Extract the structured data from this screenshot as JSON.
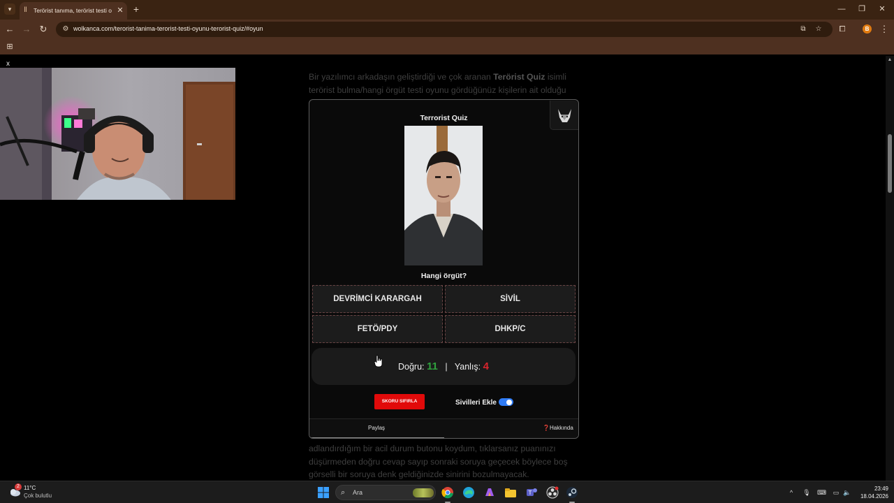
{
  "browser": {
    "tab_title": "Terörist tanıma, terörist testi oyunu - terörist quiz",
    "tab_close": "✕",
    "new_tab": "+",
    "url": "wolkanca.com/terorist-tanima-terorist-testi-oyunu-terorist-quiz/#oyun",
    "profile_initial": "B",
    "icons": [
      "tab-list-icon",
      "tab-favicon-icon",
      "close-icon",
      "plus-icon",
      "minimize-icon",
      "maximize-icon",
      "window-close-icon",
      "back-icon",
      "forward-icon",
      "reload-icon",
      "site-info-icon",
      "install-app-icon",
      "bookmark-star-icon",
      "extensions-icon",
      "menu-icon",
      "apps-grid-icon"
    ]
  },
  "overlay": {
    "close_label": "x"
  },
  "article": {
    "intro_plain_1": "Bir yazılımcı arkadaşın geliştirdiği ve çok aranan ",
    "intro_bold": "Terörist Quiz",
    "intro_plain_2": " isimli",
    "intro_line2": "terörist bulma/hangi örgüt testi oyunu gördüğünüz kişilerin ait olduğu",
    "bottom_line1": "adlandırdığım bir acil durum butonu koydum, tıklarsanız puanınızı",
    "bottom_line2": "düşürmeden doğru cevap sayıp sonraki soruya geçecek böylece boş",
    "bottom_line3": "görselli bir soruya denk geldiğinizde sinirini bozulmayacak."
  },
  "quiz": {
    "title": "Terrorist Quiz",
    "question": "Hangi örgüt?",
    "options": [
      "DEVRİMCİ KARARGAH",
      "SİVİL",
      "FETÖ/PDY",
      "DHKP/C"
    ],
    "score": {
      "correct_label": "Doğru:",
      "correct_value": "11",
      "separator": "|",
      "wrong_label": "Yanlış:",
      "wrong_value": "4"
    },
    "reset_label": "SKORU SIFIRLA",
    "civilians_label": "Sivilleri Ekle",
    "civilians_enabled": true,
    "footer_share": "Paylaş",
    "footer_about_icon": "❓",
    "footer_about": "Hakkında",
    "logo_icon": "wolf-logo-icon"
  },
  "taskbar": {
    "weather_badge": "2",
    "weather_temp": "11°C",
    "weather_desc": "Çok bulutlu",
    "search_placeholder": "Ara",
    "time": "23:49",
    "date": "18.04.2026",
    "apps": [
      "chrome-icon",
      "edge-icon",
      "copilot-icon",
      "file-explorer-icon",
      "teams-icon",
      "obs-icon",
      "steam-icon"
    ],
    "tray_icons": [
      "chevron-up-icon",
      "microphone-icon",
      "keyboard-icon",
      "display-icon",
      "speaker-icon"
    ]
  },
  "colors": {
    "chrome_dark": "#3a2312",
    "chrome_toolbar": "#4e3020",
    "correct": "#2fa13e",
    "wrong": "#d8242c",
    "reset_button": "#e10a0a",
    "toggle": "#2f7cf6"
  }
}
